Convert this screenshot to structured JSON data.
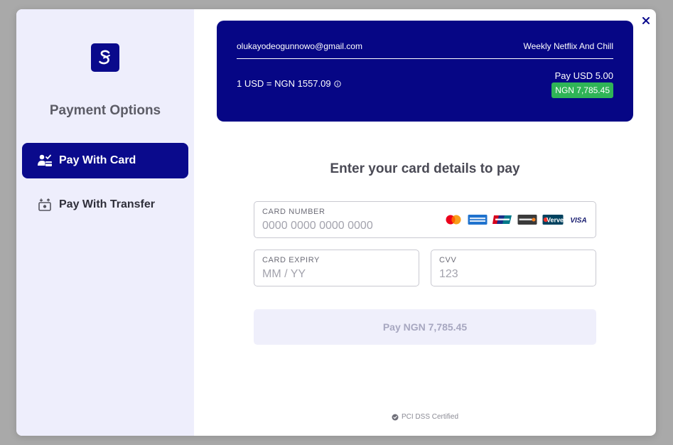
{
  "sidebar": {
    "title": "Payment Options",
    "logo_icon": "brand-logo-s",
    "items": [
      {
        "label": "Pay With Card",
        "icon": "card-user-icon",
        "active": true
      },
      {
        "label": "Pay With Transfer",
        "icon": "bank-transfer-icon",
        "active": false
      }
    ]
  },
  "summary": {
    "email": "olukayodeogunnowo@gmail.com",
    "description": "Weekly Netflix And Chill",
    "rate": "1 USD = NGN 1557.09",
    "pay_label": "Pay USD 5.00",
    "amount_badge": "NGN 7,785.45"
  },
  "form": {
    "title": "Enter your card details to pay",
    "card_number": {
      "label": "CARD NUMBER",
      "placeholder": "0000 0000 0000 0000",
      "value": ""
    },
    "card_expiry": {
      "label": "CARD EXPIRY",
      "placeholder": "MM / YY",
      "value": ""
    },
    "cvv": {
      "label": "CVV",
      "placeholder": "123",
      "value": ""
    },
    "brands": [
      "mastercard",
      "amex",
      "unionpay",
      "discover",
      "verve",
      "visa"
    ],
    "brand_texts": {
      "verve": "Verve",
      "visa": "VISA"
    },
    "pay_button": "Pay NGN 7,785.45"
  },
  "footer": {
    "text": "PCI DSS Certified"
  },
  "colors": {
    "primary": "#0a0a8c",
    "summary_bg": "#060685",
    "badge": "#2fb457",
    "sidebar_bg": "#eeeefc",
    "overlay": "#a9a9a9"
  }
}
